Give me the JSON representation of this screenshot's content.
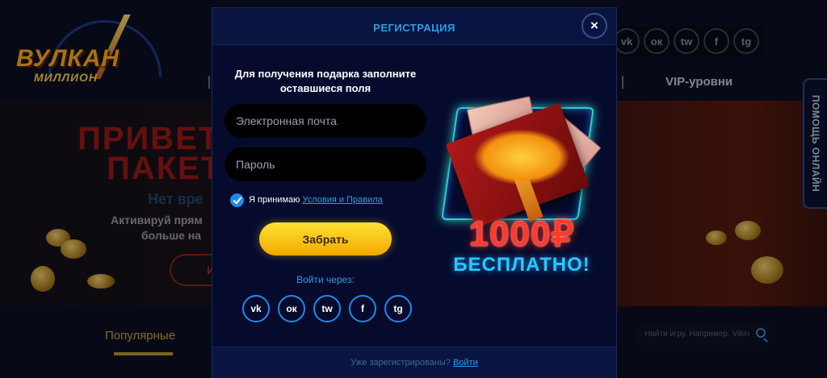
{
  "background": {
    "logo": {
      "top": "ВУЛКАН",
      "bottom": "МИЛЛИОН"
    },
    "nav": {
      "vip_label": "VIP-уровни"
    },
    "help_tab_label": "ПОМОЩЬ ОНЛАЙН",
    "hero": {
      "title_line1": "ПРИВЕТС",
      "title_line2": "ПАКЕТ",
      "subtitle": "Нет вре",
      "text_line1": "Активируй прям",
      "text_line2": "больше на",
      "button_label": "И"
    },
    "popular_tab": "Популярные",
    "search_placeholder": "Найти игру. Например, Vikin"
  },
  "modal": {
    "title": "РЕГИСТРАЦИЯ",
    "close_label": "×",
    "form_title": "Для получения подарка заполните оставшиеся поля",
    "email_placeholder": "Электронная почта",
    "password_placeholder": "Пароль",
    "terms_text": "Я принимаю",
    "terms_link": "Условия и Правила",
    "terms_checked": true,
    "claim_button": "Забрать",
    "login_via": "Войти через:",
    "social": [
      {
        "icon": "vk-icon",
        "label": "vk"
      },
      {
        "icon": "odnoklassniki-icon",
        "label": "ок"
      },
      {
        "icon": "twitter-icon",
        "label": "tw"
      },
      {
        "icon": "facebook-icon",
        "label": "f"
      },
      {
        "icon": "telegram-icon",
        "label": "tg"
      }
    ],
    "promo": {
      "amount": "1000₽",
      "free": "БЕСПЛАТНО!"
    },
    "footer_text": "Уже зарегистрированы?",
    "footer_link": "Войти"
  },
  "colors": {
    "accent": "#2a9ee8",
    "button_yellow": "#ffd21e",
    "modal_bg": "#060b2e"
  }
}
